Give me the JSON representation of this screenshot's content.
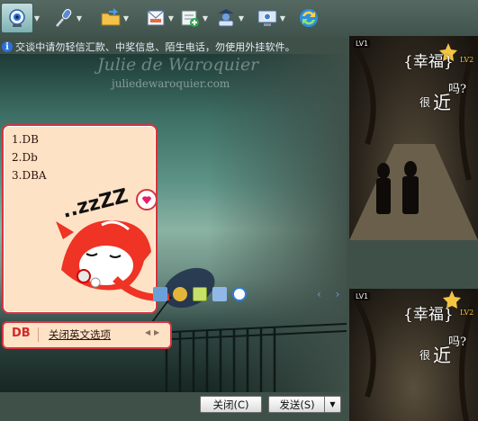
{
  "toolbar": {
    "items": [
      {
        "name": "webcam-icon"
      },
      {
        "name": "microphone-icon"
      },
      {
        "name": "folder-transfer-icon"
      },
      {
        "name": "mail-send-icon"
      },
      {
        "name": "add-app-icon"
      },
      {
        "name": "user-card-icon"
      },
      {
        "name": "remote-assist-icon"
      },
      {
        "name": "app-switch-icon"
      }
    ]
  },
  "notice": {
    "text": "交谈中请勿轻信汇款、中奖信息、陌生电话，勿使用外挂软件。"
  },
  "background": {
    "watermark_title": "Julie de Waroquier",
    "watermark_url": "juliedewaroquier.com"
  },
  "suggestions": {
    "items": [
      "1.DB",
      "2.Db",
      "3.DBA"
    ]
  },
  "mascot": {
    "sleep_text": "..zzZZ"
  },
  "ime": {
    "input": "DB",
    "option_label": "关闭英文选项",
    "prev_label": "◀",
    "next_label": "▶"
  },
  "buttons": {
    "close_label": "关闭(C)",
    "send_label": "发送(S)",
    "send_menu_label": "▼"
  },
  "avatar_top": {
    "level": "LV1",
    "lv2": "LV2",
    "text_happy": "{幸福}",
    "text_q": "吗?",
    "text_hen": "很",
    "text_jin": "近"
  },
  "avatar_bottom": {
    "level": "LV1",
    "lv2": "LV2",
    "text_happy": "{幸福}",
    "text_q": "吗?",
    "text_hen": "很",
    "text_jin": "近"
  },
  "colors": {
    "accent_red": "#d7343f",
    "panel_peach": "#fde2c5",
    "window_bg": "#3f5049"
  }
}
